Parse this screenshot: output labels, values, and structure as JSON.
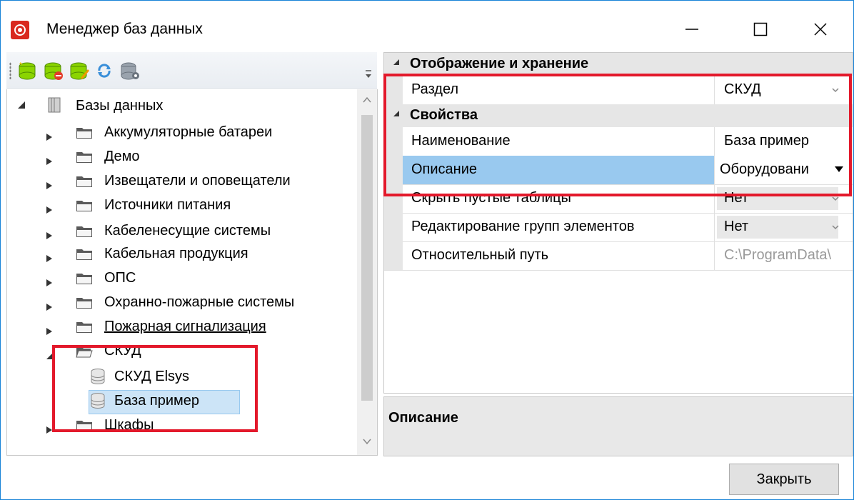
{
  "window": {
    "title": "Менеджер баз данных"
  },
  "toolbar": {
    "buttons": [
      "add-database-icon",
      "delete-database-icon",
      "edit-database-icon",
      "refresh-icon",
      "database-settings-icon"
    ]
  },
  "tree": {
    "root": "Базы данных",
    "items": [
      {
        "label": "Аккумуляторные батареи"
      },
      {
        "label": "Демо"
      },
      {
        "label": "Извещатели и оповещатели"
      },
      {
        "label": "Источники питания"
      },
      {
        "label": "Кабеленесущие системы"
      },
      {
        "label": "Кабельная продукция"
      },
      {
        "label": "ОПС"
      },
      {
        "label": "Охранно-пожарные системы"
      },
      {
        "label": "Пожарная сигнализация"
      },
      {
        "label": "СКУД"
      },
      {
        "label": "СКУД Elsys"
      },
      {
        "label": "База пример"
      },
      {
        "label": "Шкафы"
      }
    ]
  },
  "properties": {
    "cat1": "Отображение и хранение",
    "razdel_name": "Раздел",
    "razdel_value": "СКУД",
    "cat2": "Свойства",
    "name_name": "Наименование",
    "name_value": "База пример",
    "desc_name": "Описание",
    "desc_value": "Оборудовани",
    "hide_name": "Скрыть пустые таблицы",
    "hide_value": "Нет",
    "edit_name": "Редактирование групп элементов",
    "edit_value": "Нет",
    "path_name": "Относительный путь",
    "path_value": "C:\\ProgramData\\"
  },
  "description_panel": {
    "title": "Описание"
  },
  "buttons": {
    "close": "Закрыть"
  },
  "colors": {
    "accent_border": "#1883d7",
    "highlight_red": "#e3192b",
    "selection": "#cce4f7",
    "property_selected": "#99c9ef"
  }
}
